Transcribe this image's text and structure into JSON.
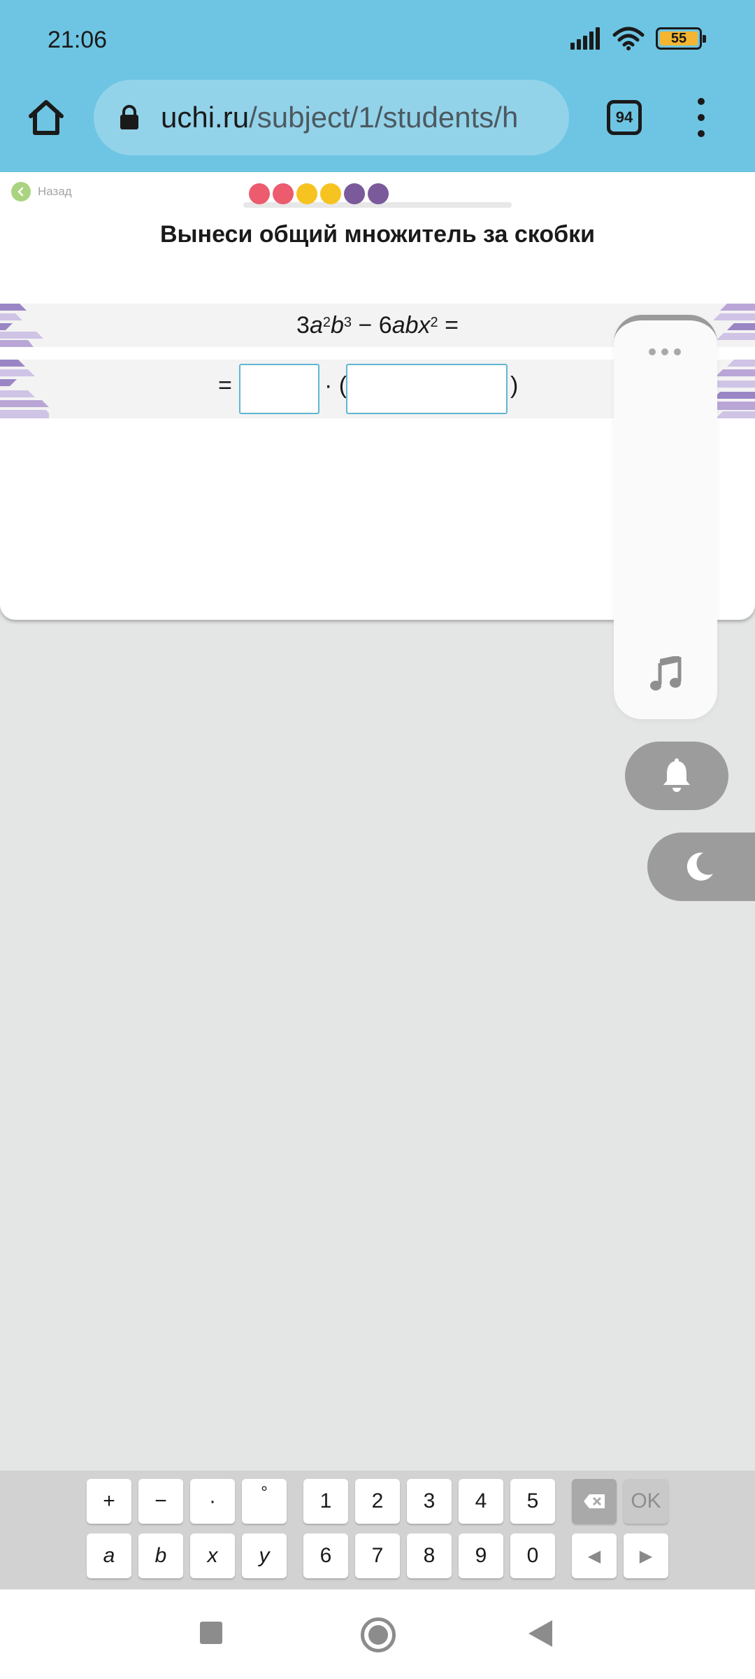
{
  "status_bar": {
    "time": "21:06",
    "battery": "55",
    "icons": [
      "signal-icon",
      "wifi-icon",
      "battery-icon"
    ]
  },
  "browser": {
    "url_domain": "uchi.ru",
    "url_path": "/subject/1/students/h",
    "tab_count": "94",
    "icons": [
      "home-icon",
      "lock-icon",
      "menu-icon"
    ]
  },
  "lesson": {
    "back_label": "Назад",
    "progress_colors": [
      "#ec5b6e",
      "#ec5b6e",
      "#f6c320",
      "#f6c320",
      "#7a5a9b",
      "#7a5a9b"
    ],
    "title": "Вынеси общий множитель за скобки"
  },
  "expression": {
    "coef1": "3",
    "var_a": "a",
    "exp_a": "2",
    "var_b": "b",
    "exp_b": "3",
    "minus": " − 6",
    "vars_abx": "abx",
    "exp_x": "2",
    "equals": " ="
  },
  "answer": {
    "equals": "=",
    "dot_open": "· (",
    "close": ")"
  },
  "side_panel": {
    "icons": [
      "more-icon",
      "music-icon",
      "bell-icon",
      "moon-icon"
    ]
  },
  "keyboard": {
    "row1": [
      "+",
      "−",
      "·",
      "°",
      "1",
      "2",
      "3",
      "4",
      "5"
    ],
    "row2": [
      "a",
      "b",
      "x",
      "y",
      "6",
      "7",
      "8",
      "9",
      "0"
    ],
    "backspace_icon": "backspace-icon",
    "ok_label": "OK",
    "left_arrow": "◀",
    "right_arrow": "▶"
  },
  "accent": {
    "header_blue": "#6ec5e3",
    "input_border": "#61b6d3",
    "decor_purple": "#b9a6d6"
  }
}
